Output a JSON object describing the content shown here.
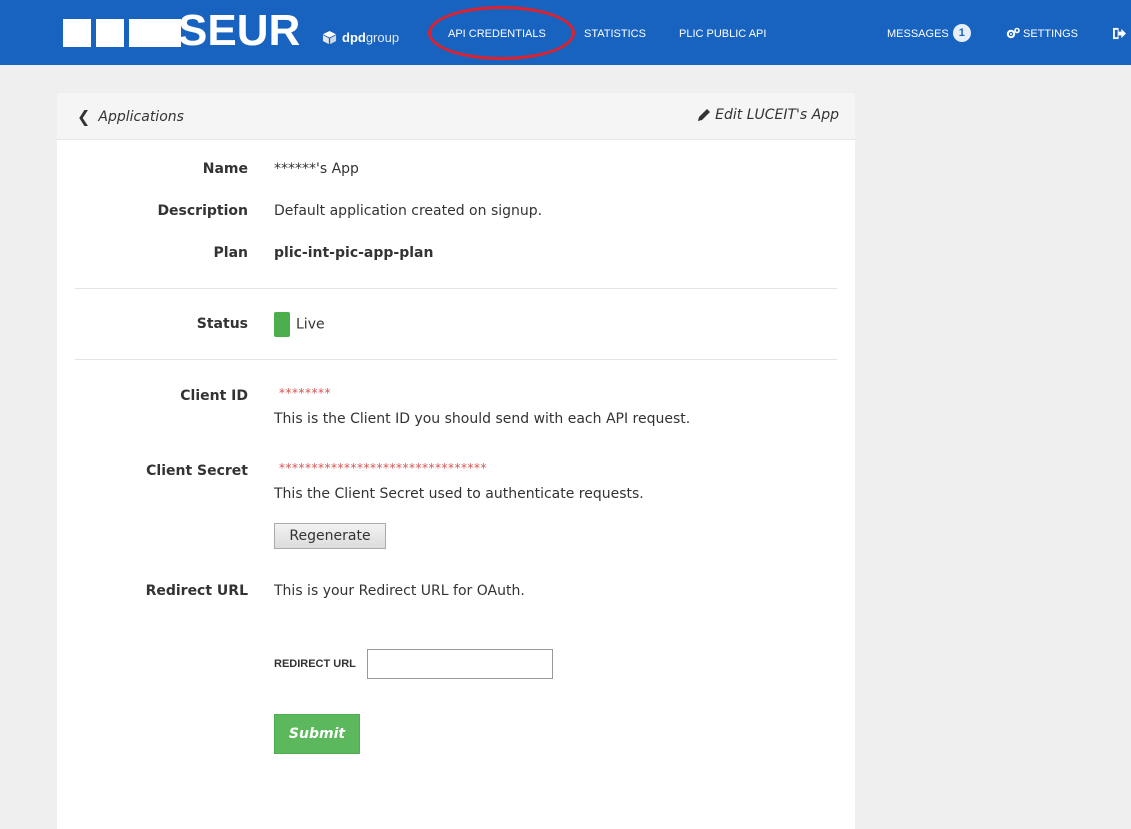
{
  "brand": {
    "logo_text": "SEUR",
    "dpd_bold": "dpd",
    "dpd_light": "group"
  },
  "nav": {
    "api_credentials": "API CREDENTIALS",
    "statistics": "STATISTICS",
    "plic_public_api": "PLIC PUBLIC API",
    "messages": "MESSAGES",
    "messages_count": "1",
    "settings": "SETTINGS"
  },
  "colors": {
    "navbar": "#1863c0",
    "annotation": "#e0202a",
    "live": "#4cae4c",
    "masked": "#d9534f",
    "submit": "#5cb85c"
  },
  "card": {
    "back_label": "Applications",
    "edit_label": "Edit LUCEIT's App"
  },
  "details": {
    "name_label": "Name",
    "name_value": "******'s App",
    "description_label": "Description",
    "description_value": "Default application created on signup.",
    "plan_label": "Plan",
    "plan_value": "plic-int-pic-app-plan",
    "status_label": "Status",
    "status_value": "Live",
    "client_id_label": "Client ID",
    "client_id_value": "********",
    "client_id_help": "This is the Client ID you should send with each API request.",
    "client_secret_label": "Client Secret",
    "client_secret_value": "********************************",
    "client_secret_help": "This the Client Secret used to authenticate requests.",
    "regenerate_label": "Regenerate",
    "redirect_label": "Redirect URL",
    "redirect_help": "This is your Redirect URL for OAuth.",
    "redirect_field_label": "REDIRECT URL",
    "redirect_field_value": "",
    "submit_label": "Submit"
  }
}
